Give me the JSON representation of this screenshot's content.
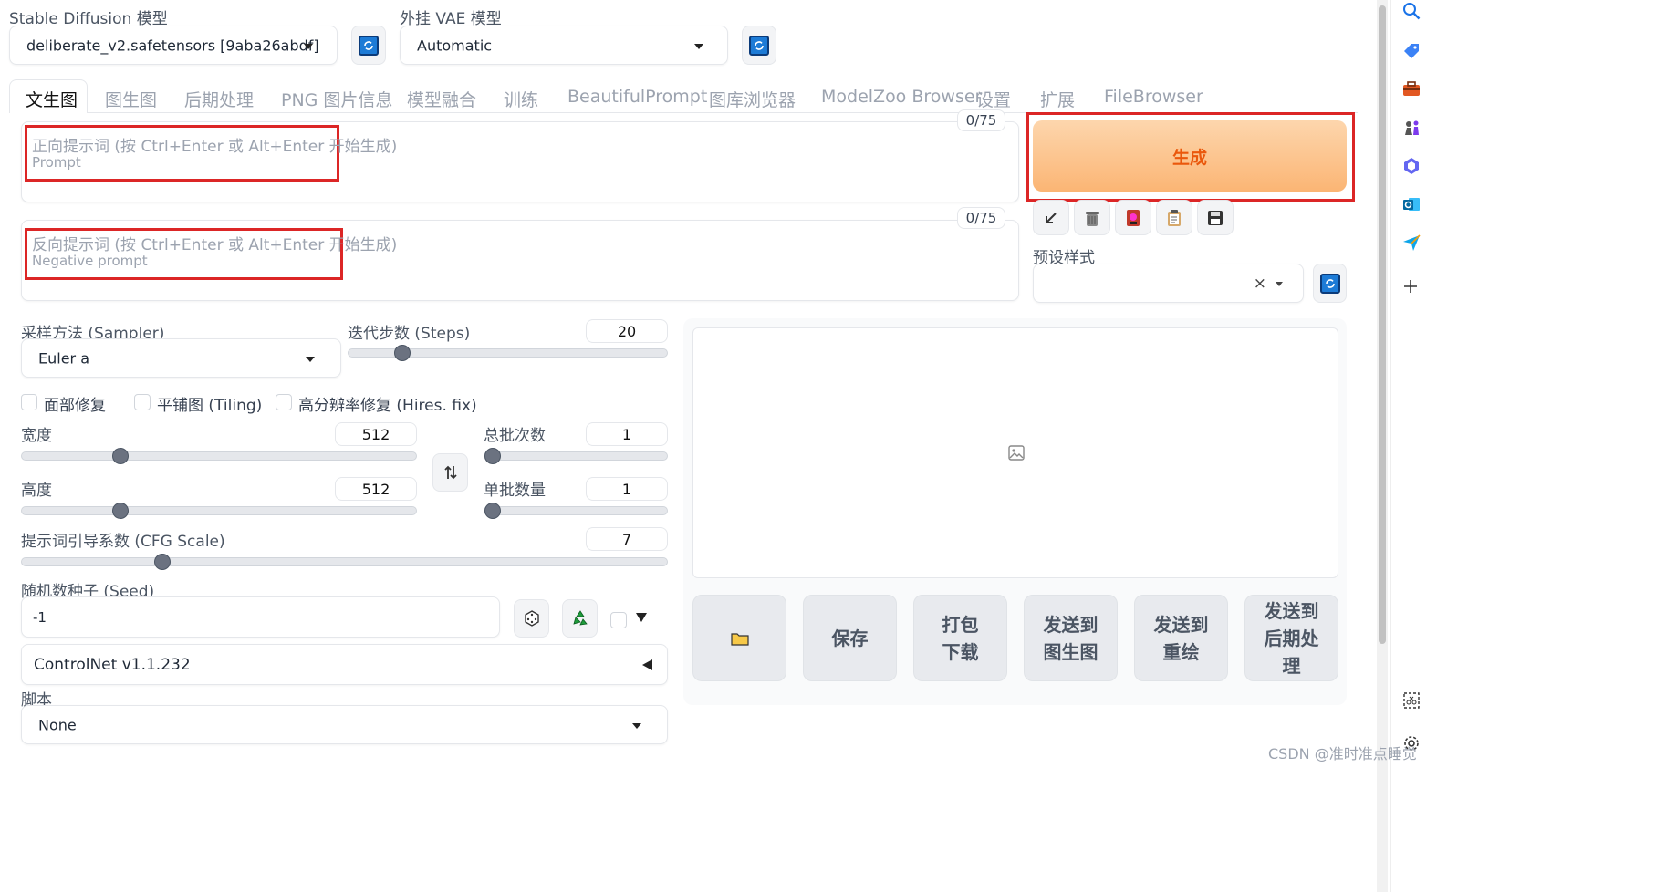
{
  "top": {
    "sd_model_label": "Stable Diffusion 模型",
    "sd_model_value": "deliberate_v2.safetensors [9aba26abdf]",
    "vae_label": "外挂 VAE 模型",
    "vae_value": "Automatic"
  },
  "tabs": [
    {
      "label": "文生图",
      "active": true
    },
    {
      "label": "图生图"
    },
    {
      "label": "后期处理"
    },
    {
      "label": "PNG 图片信息"
    },
    {
      "label": "模型融合"
    },
    {
      "label": "训练"
    },
    {
      "label": "BeautifulPrompt"
    },
    {
      "label": "图库浏览器"
    },
    {
      "label": "ModelZoo Browser"
    },
    {
      "label": "设置"
    },
    {
      "label": "扩展"
    },
    {
      "label": "FileBrowser"
    }
  ],
  "prompt": {
    "placeholder_line1": "正向提示词 (按 Ctrl+Enter 或 Alt+Enter 开始生成)",
    "placeholder_line2": "Prompt",
    "counter": "0/75"
  },
  "negative": {
    "placeholder_line1": "反向提示词 (按 Ctrl+Enter 或 Alt+Enter 开始生成)",
    "placeholder_line2": "Negative prompt",
    "counter": "0/75"
  },
  "generate_label": "生成",
  "styles": {
    "label": "预设样式",
    "clear_symbol": "×"
  },
  "sampler": {
    "label": "采样方法 (Sampler)",
    "value": "Euler a"
  },
  "steps": {
    "label": "迭代步数 (Steps)",
    "value": "20",
    "fraction": 0.15
  },
  "checks": {
    "face": "面部修复",
    "tiling": "平铺图 (Tiling)",
    "hires": "高分辨率修复 (Hires. fix)"
  },
  "width": {
    "label": "宽度",
    "value": "512",
    "fraction": 0.24
  },
  "height": {
    "label": "高度",
    "value": "512",
    "fraction": 0.24
  },
  "batch_count": {
    "label": "总批次数",
    "value": "1",
    "fraction": 0.0
  },
  "batch_size": {
    "label": "单批数量",
    "value": "1",
    "fraction": 0.0
  },
  "cfg": {
    "label": "提示词引导系数 (CFG Scale)",
    "value": "7",
    "fraction": 0.21
  },
  "seed": {
    "label": "随机数种子 (Seed)",
    "value": "-1"
  },
  "controlnet": {
    "label": "ControlNet v1.1.232"
  },
  "script": {
    "label": "脚本",
    "value": "None"
  },
  "actions": {
    "save": "保存",
    "zip": "打包下载",
    "to_img2img": "发送到图生图",
    "to_inpaint": "发送到重绘",
    "to_extras": "发送到后期处理"
  },
  "watermark": "CSDN @准时准点睡觉",
  "colors": {
    "accent": "#fbb574",
    "highlight": "#dc2626",
    "generate_text": "#ea580c"
  }
}
